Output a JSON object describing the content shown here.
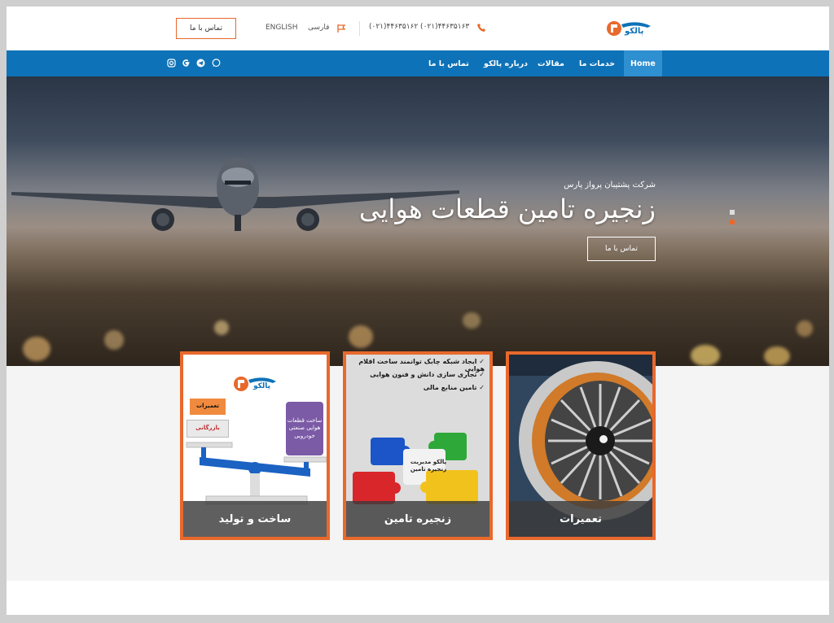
{
  "topbar": {
    "contact_button": "تماس با ما",
    "lang_english": "ENGLISH",
    "lang_farsi": "فارسی",
    "phone": "(۰۲۱)۴۴۶۳۵۱۶۲ (۰۲۱)۴۴۶۳۵۱۶۳",
    "logo_text": "پالکو"
  },
  "nav": {
    "items": [
      "Home",
      "خدمات ما",
      "مقالات",
      "درباره پالکو",
      "تماس با ما"
    ]
  },
  "hero": {
    "subtitle": "شرکت پشتیبان پرواز پارس",
    "title": "زنجیره تامین قطعات هوایی",
    "button": "تماس با ما"
  },
  "cards": [
    {
      "caption": "ساخت و تولید",
      "logo_text": "پالکو",
      "badges": {
        "repairs": "تعمیرات",
        "commerce": "بازرگانی",
        "parts": "ساخت قطعات هوایی صنعتی خودرویی"
      }
    },
    {
      "caption": "زنجیره تامین",
      "checks": [
        "ایجاد شبکه چابک توانمند ساخت اقلام هوایی",
        "تجاری سازی دانش و فنون هوایی",
        "تامین منابع مالی"
      ],
      "puzzle_center": "پالکو مدیریت زنجیره تامین"
    },
    {
      "caption": "تعمیرات"
    }
  ],
  "colors": {
    "brand_orange": "#e8692c",
    "nav_blue": "#0e72b8"
  }
}
